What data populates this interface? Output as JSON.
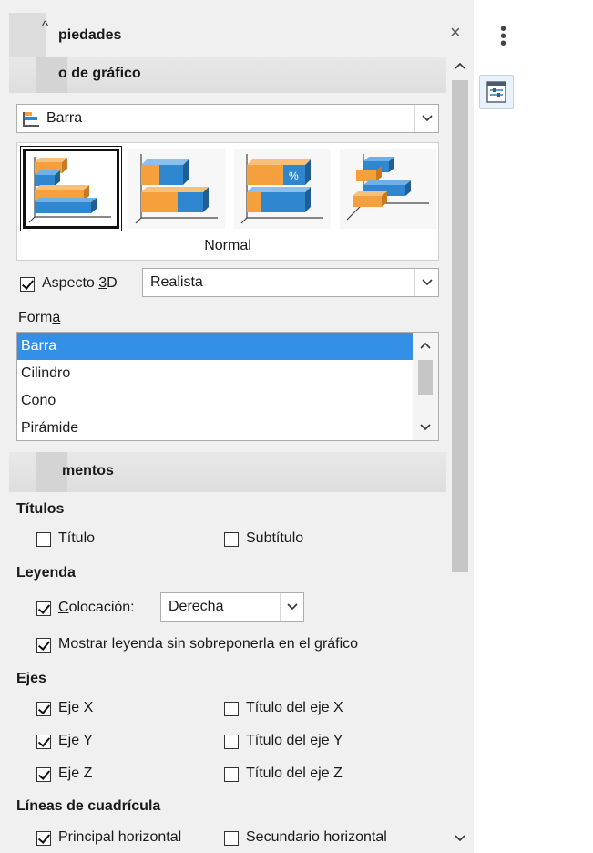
{
  "panel": {
    "title": "piedades",
    "close_glyph": "×",
    "collapse_glyph": "^"
  },
  "chart_type_section": {
    "header": "o de gráfico",
    "type_dropdown": {
      "value": "Barra",
      "icon": "bar-chart-icon"
    },
    "variants": [
      {
        "name": "normal",
        "selected": true
      },
      {
        "name": "stacked",
        "selected": false
      },
      {
        "name": "percent-stacked",
        "selected": false,
        "badge": "%"
      },
      {
        "name": "deep",
        "selected": false
      }
    ],
    "variant_caption": "Normal",
    "aspect3d": {
      "label_pre": "Aspecto ",
      "label_accel": "3",
      "label_post": "D",
      "checked": true
    },
    "aspect3d_dropdown": {
      "value": "Realista"
    },
    "shape_label_pre": "Form",
    "shape_label_accel": "a",
    "shape_list": [
      "Barra",
      "Cilindro",
      "Cono",
      "Pirámide"
    ],
    "shape_selected": "Barra"
  },
  "elements_section": {
    "header": "mentos",
    "titles_heading": "Títulos",
    "title_cb": {
      "label": "Título",
      "checked": false
    },
    "subtitle_cb": {
      "label": "Subtítulo",
      "checked": false
    },
    "legend_heading": "Leyenda",
    "placement_cb": {
      "label_accel": "C",
      "label_rest": "olocación:",
      "checked": true
    },
    "placement_dropdown": {
      "value": "Derecha"
    },
    "no_overlap_cb": {
      "label": "Mostrar leyenda sin sobreponerla en el gráfico",
      "checked": true
    },
    "axes_heading": "Ejes",
    "axes": [
      {
        "label": "Eje X",
        "checked": true,
        "title_label": "Título del eje X",
        "title_checked": false
      },
      {
        "label": "Eje Y",
        "checked": true,
        "title_label": "Título del eje Y",
        "title_checked": false
      },
      {
        "label": "Eje Z",
        "checked": true,
        "title_label": "Título del eje Z",
        "title_checked": false
      }
    ],
    "grid_heading": "Líneas de cuadrícula",
    "grid_major_h": {
      "label": "Principal horizontal",
      "checked": true
    },
    "grid_minor_h": {
      "label": "Secundario horizontal",
      "checked": false
    }
  },
  "sidebar": {
    "menu_glyph": "⋮",
    "properties_button_icon": "properties-deck-icon"
  },
  "colors": {
    "bar_orange": "#f5a03c",
    "bar_blue": "#2f87cf",
    "selection_blue": "#3390e6"
  }
}
